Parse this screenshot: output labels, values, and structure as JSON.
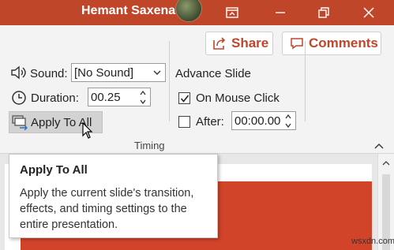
{
  "titlebar": {
    "user_name": "Hemant Saxena"
  },
  "ribbon": {
    "share_label": "Share",
    "comments_label": "Comments",
    "sound_label": "Sound:",
    "sound_value": "[No Sound]",
    "duration_label": "Duration:",
    "duration_value": "00.25",
    "apply_label": "Apply To All",
    "group_label": "Timing",
    "advance_heading": "Advance Slide",
    "on_mouse_click_label": "On Mouse Click",
    "on_mouse_click_checked": true,
    "after_label": "After:",
    "after_checked": false,
    "after_value": "00:00.00"
  },
  "tooltip": {
    "title": "Apply To All",
    "body": "Apply the current slide's transition, effects, and timing settings to the entire presentation."
  },
  "watermark": "wsxdn.com",
  "colors": {
    "accent": "#c0462a",
    "slide_red": "#d2442a"
  },
  "icons": [
    "avatar",
    "ribbon-display-icon",
    "minimize-icon",
    "restore-icon",
    "close-icon",
    "share-icon",
    "comment-icon",
    "speaker-icon",
    "clock-icon",
    "apply-to-all-icon",
    "chevron-up-icon",
    "chevron-down-icon",
    "spin-up-icon",
    "spin-down-icon",
    "checkmark-icon",
    "scroll-up-icon",
    "mouse-cursor-icon"
  ]
}
